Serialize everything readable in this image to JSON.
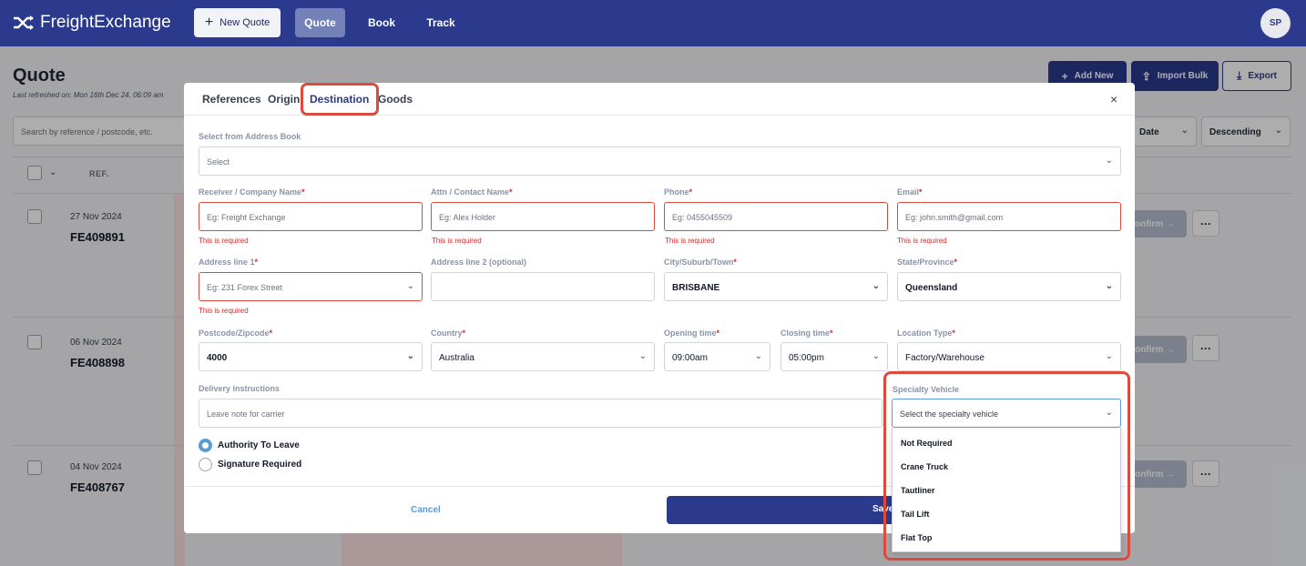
{
  "app": {
    "brand": "FreightExchange",
    "new_quote": "New Quote",
    "nav": [
      "Quote",
      "Book",
      "Track"
    ],
    "avatar": "SP"
  },
  "page": {
    "title": "Quote",
    "refreshed": "Last refreshed on: Mon 16th Dec 24, 06:09 am",
    "add_new": "Add New",
    "import_bulk": "Import Bulk",
    "export": "Export",
    "search_placeholder": "Search by reference / postcode, etc.",
    "sort_field": "Date",
    "sort_order": "Descending",
    "col_ref": "REF.",
    "confirm_label": "Confirm",
    "more_label": "···",
    "rows": [
      {
        "date": "27 Nov 2024",
        "id": "FE409891"
      },
      {
        "date": "06 Nov 2024",
        "id": "FE408898"
      },
      {
        "date": "04 Nov 2024",
        "id": "FE408767"
      }
    ]
  },
  "modal": {
    "tabs": [
      "References",
      "Origin",
      "Destination",
      "Goods"
    ],
    "active_tab": "Destination",
    "close": "×",
    "address_book": {
      "label": "Select from Address Book",
      "placeholder": "Select"
    },
    "fields": {
      "company": {
        "label": "Receiver / Company Name",
        "placeholder": "Eg: Freight Exchange",
        "error": "This is required"
      },
      "contact": {
        "label": "Attn / Contact Name",
        "placeholder": "Eg: Alex Holder",
        "error": "This is required"
      },
      "phone": {
        "label": "Phone",
        "placeholder": "Eg: 0455045509",
        "error": "This is required"
      },
      "email": {
        "label": "Email",
        "placeholder": "Eg: john.smith@gmail.com",
        "error": "This is required"
      },
      "address1": {
        "label": "Address line 1",
        "placeholder": "Eg: 231 Forex Street",
        "error": "This is required"
      },
      "address2": {
        "label": "Address line 2 (optional)",
        "value": ""
      },
      "city": {
        "label": "City/Suburb/Town",
        "value": "BRISBANE"
      },
      "state": {
        "label": "State/Province",
        "value": "Queensland"
      },
      "postcode": {
        "label": "Postcode/Zipcode",
        "value": "4000"
      },
      "country": {
        "label": "Country",
        "value": "Australia"
      },
      "opening": {
        "label": "Opening time",
        "value": "09:00am"
      },
      "closing": {
        "label": "Closing time",
        "value": "05:00pm"
      },
      "location_type": {
        "label": "Location Type",
        "value": "Factory/Warehouse"
      },
      "instructions": {
        "label": "Delivery instructions",
        "placeholder": "Leave note for carrier"
      }
    },
    "radios": [
      {
        "label": "Authority To Leave",
        "selected": true
      },
      {
        "label": "Signature Required",
        "selected": false
      }
    ],
    "specialty": {
      "label": "Specialty Vehicle",
      "placeholder": "Select the specialty vehicle",
      "options": [
        "Not Required",
        "Crane Truck",
        "Tautliner",
        "Tail Lift",
        "Flat Top"
      ]
    },
    "cancel": "Cancel",
    "save": "Save"
  },
  "colors": {
    "primary": "#2b3a8c",
    "error": "#dc2626",
    "highlight": "#dc4b3e",
    "link": "#5b9bd5"
  }
}
